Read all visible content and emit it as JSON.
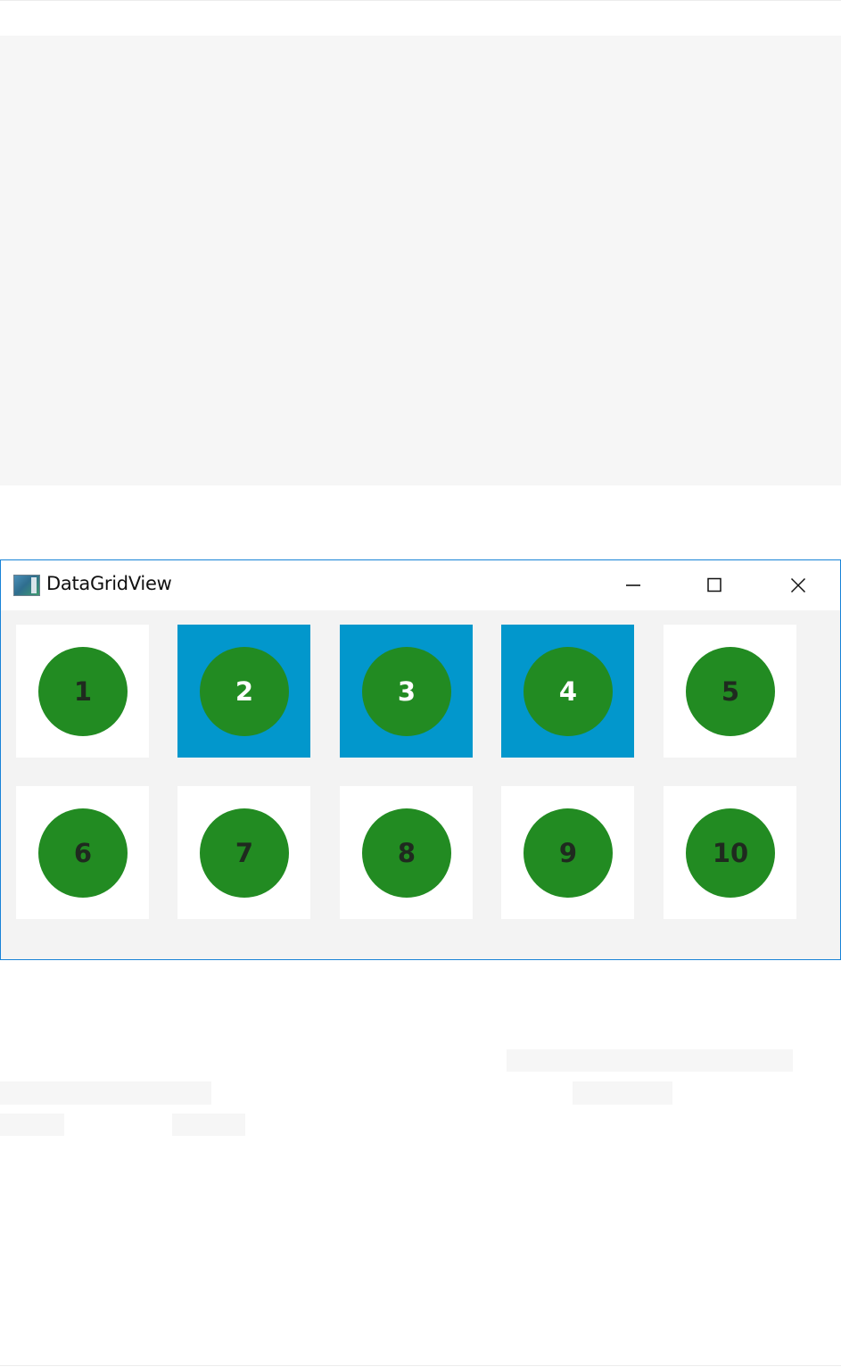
{
  "window": {
    "title": "DataGridView",
    "border_color": "#1883d7"
  },
  "caption_buttons": {
    "minimize_icon": "minimize-icon",
    "maximize_icon": "maximize-icon",
    "close_icon": "close-icon"
  },
  "grid": {
    "circle_color": "#228b22",
    "selected_color": "#0297cc",
    "tiles": [
      {
        "label": "1",
        "selected": false
      },
      {
        "label": "2",
        "selected": true
      },
      {
        "label": "3",
        "selected": true
      },
      {
        "label": "4",
        "selected": true
      },
      {
        "label": "5",
        "selected": false
      },
      {
        "label": "6",
        "selected": false
      },
      {
        "label": "7",
        "selected": false
      },
      {
        "label": "8",
        "selected": false
      },
      {
        "label": "9",
        "selected": false
      },
      {
        "label": "10",
        "selected": false
      }
    ]
  }
}
